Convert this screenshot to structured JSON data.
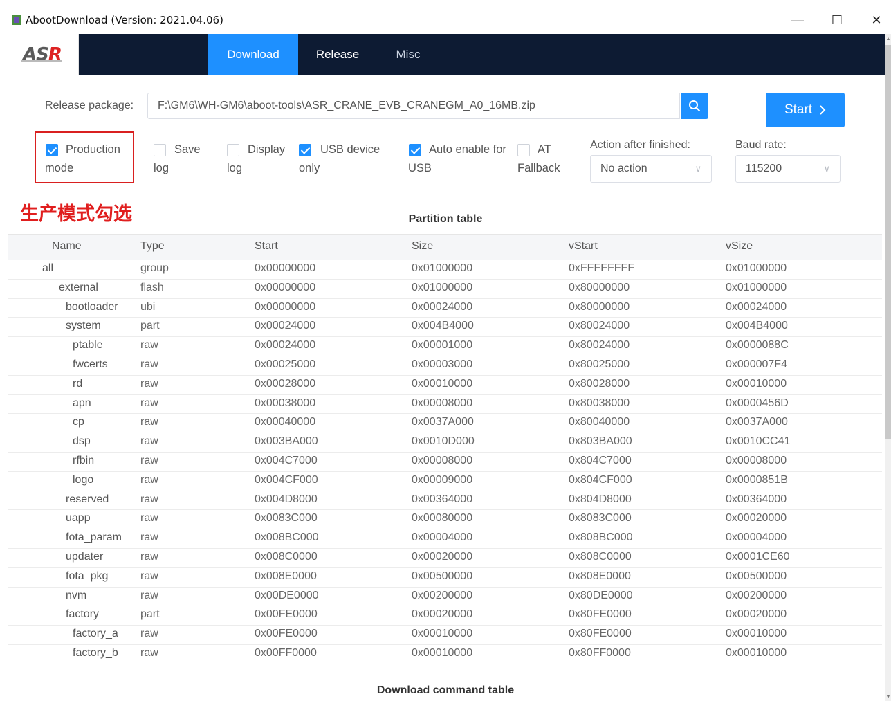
{
  "window": {
    "title": "AbootDownload (Version: 2021.04.06)",
    "controls": {
      "minimize": "—",
      "maximize": "☐",
      "close": "✕"
    }
  },
  "nav": {
    "logo_left": "AS",
    "logo_right": "R",
    "tabs": [
      {
        "label": "Download",
        "active": true
      },
      {
        "label": "Release",
        "active": false
      },
      {
        "label": "Misc",
        "active": false
      }
    ]
  },
  "form": {
    "release_label": "Release package:",
    "release_value": "F:\\GM6\\WH-GM6\\aboot-tools\\ASR_CRANE_EVB_CRANEGM_A0_16MB.zip",
    "start_label": "Start",
    "start_chevron": "›",
    "options": [
      {
        "line1": "Production",
        "line2": "mode",
        "checked": true
      },
      {
        "line1": "Save",
        "line2": "log",
        "checked": false
      },
      {
        "line1": "Display",
        "line2": "log",
        "checked": false
      },
      {
        "line1": "USB device",
        "line2": "only",
        "checked": true
      },
      {
        "line1": "Auto enable for",
        "line2": "USB",
        "checked": true
      },
      {
        "line1": "AT",
        "line2": "Fallback",
        "checked": false
      }
    ],
    "action_label": "Action after finished:",
    "action_value": "No action",
    "baud_label": "Baud rate:",
    "baud_value": "115200",
    "select_chevron": "∨"
  },
  "annotation": "生产模式勾选",
  "partition_table": {
    "title": "Partition table",
    "headers": [
      "Name",
      "Type",
      "Start",
      "Size",
      "vStart",
      "vSize"
    ],
    "rows": [
      [
        "all",
        "group",
        "0x00000000",
        "0x01000000",
        "0xFFFFFFFF",
        "0x01000000"
      ],
      [
        "external",
        "flash",
        "0x00000000",
        "0x01000000",
        "0x80000000",
        "0x01000000"
      ],
      [
        "bootloader",
        "ubi",
        "0x00000000",
        "0x00024000",
        "0x80000000",
        "0x00024000"
      ],
      [
        "system",
        "part",
        "0x00024000",
        "0x004B4000",
        "0x80024000",
        "0x004B4000"
      ],
      [
        "ptable",
        "raw",
        "0x00024000",
        "0x00001000",
        "0x80024000",
        "0x0000088C"
      ],
      [
        "fwcerts",
        "raw",
        "0x00025000",
        "0x00003000",
        "0x80025000",
        "0x000007F4"
      ],
      [
        "rd",
        "raw",
        "0x00028000",
        "0x00010000",
        "0x80028000",
        "0x00010000"
      ],
      [
        "apn",
        "raw",
        "0x00038000",
        "0x00008000",
        "0x80038000",
        "0x0000456D"
      ],
      [
        "cp",
        "raw",
        "0x00040000",
        "0x0037A000",
        "0x80040000",
        "0x0037A000"
      ],
      [
        "dsp",
        "raw",
        "0x003BA000",
        "0x0010D000",
        "0x803BA000",
        "0x0010CC41"
      ],
      [
        "rfbin",
        "raw",
        "0x004C7000",
        "0x00008000",
        "0x804C7000",
        "0x00008000"
      ],
      [
        "logo",
        "raw",
        "0x004CF000",
        "0x00009000",
        "0x804CF000",
        "0x0000851B"
      ],
      [
        "reserved",
        "raw",
        "0x004D8000",
        "0x00364000",
        "0x804D8000",
        "0x00364000"
      ],
      [
        "uapp",
        "raw",
        "0x0083C000",
        "0x00080000",
        "0x8083C000",
        "0x00020000"
      ],
      [
        "fota_param",
        "raw",
        "0x008BC000",
        "0x00004000",
        "0x808BC000",
        "0x00004000"
      ],
      [
        "updater",
        "raw",
        "0x008C0000",
        "0x00020000",
        "0x808C0000",
        "0x0001CE60"
      ],
      [
        "fota_pkg",
        "raw",
        "0x008E0000",
        "0x00500000",
        "0x808E0000",
        "0x00500000"
      ],
      [
        "nvm",
        "raw",
        "0x00DE0000",
        "0x00200000",
        "0x80DE0000",
        "0x00200000"
      ],
      [
        "factory",
        "part",
        "0x00FE0000",
        "0x00020000",
        "0x80FE0000",
        "0x00020000"
      ],
      [
        "factory_a",
        "raw",
        "0x00FE0000",
        "0x00010000",
        "0x80FE0000",
        "0x00010000"
      ],
      [
        "factory_b",
        "raw",
        "0x00FF0000",
        "0x00010000",
        "0x80FF0000",
        "0x00010000"
      ]
    ]
  },
  "command_table": {
    "title": "Download command table"
  }
}
